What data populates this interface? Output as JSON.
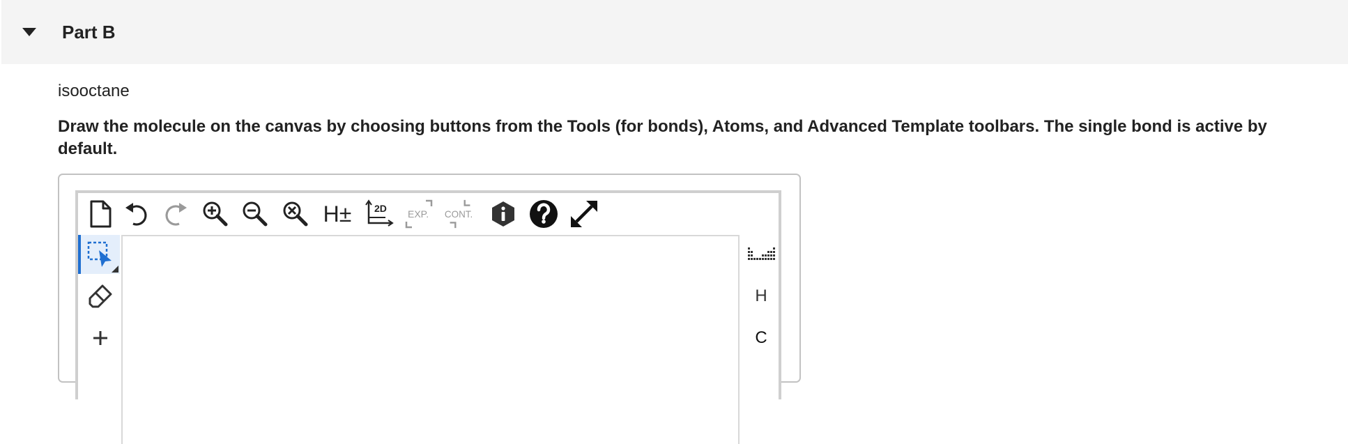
{
  "part": {
    "title": "Part B"
  },
  "question": {
    "molecule_name": "isooctane",
    "instructions": "Draw the molecule on the canvas by choosing buttons from the Tools (for bonds), Atoms, and Advanced Template toolbars. The single bond is active by default."
  },
  "top_toolbar": {
    "h_toggle_label": "H±",
    "two_d_label": "2D",
    "expand_label": "EXP.",
    "contract_label": "CONT."
  },
  "atoms_toolbar": {
    "atoms": [
      "H",
      "C"
    ]
  },
  "colors": {
    "accent": "#1f6fd1",
    "header_bg": "#f4f4f4",
    "disabled": "#9a9a9a"
  }
}
